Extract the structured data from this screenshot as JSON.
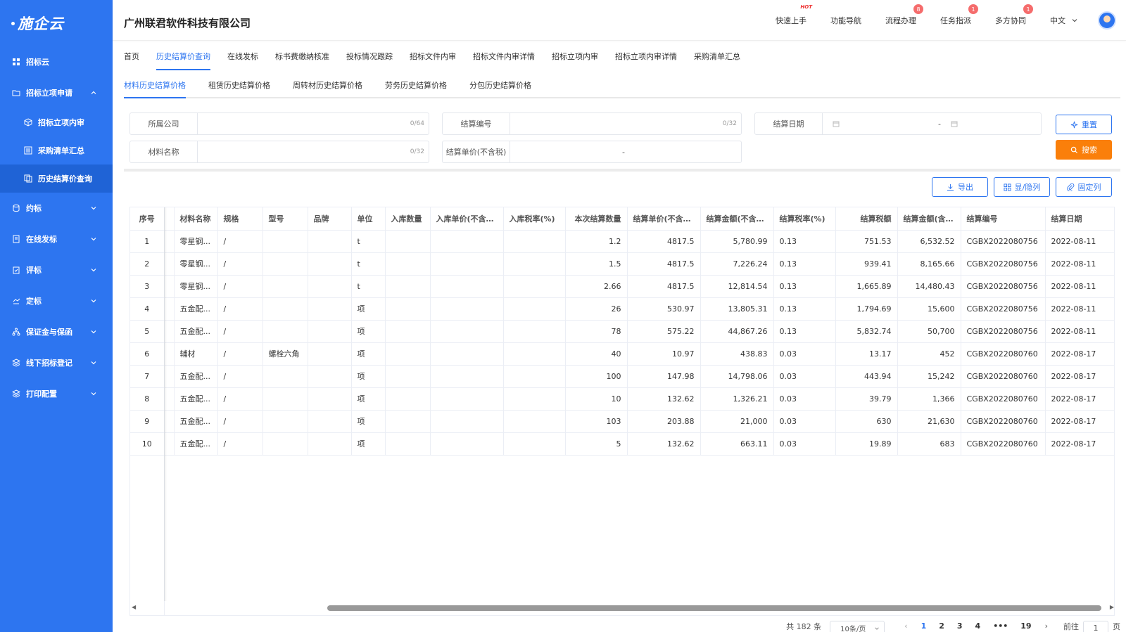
{
  "brand": {
    "logo_text": "施企云"
  },
  "sidebar": {
    "items": [
      {
        "label": "招标云",
        "icon": "grid-icon",
        "chevron": false
      },
      {
        "label": "招标立项申请",
        "icon": "folder-icon",
        "chevron": true,
        "expanded": true
      },
      {
        "label": "招标立项内审",
        "icon": "cube-icon",
        "sub": true
      },
      {
        "label": "采购清单汇总",
        "icon": "list-icon",
        "sub": true
      },
      {
        "label": "历史结算价查询",
        "icon": "copy-icon",
        "sub": true,
        "active": true
      },
      {
        "label": "约标",
        "icon": "coins-icon",
        "chevron": true
      },
      {
        "label": "在线发标",
        "icon": "doc-icon",
        "chevron": true
      },
      {
        "label": "评标",
        "icon": "clipboard-icon",
        "chevron": true
      },
      {
        "label": "定标",
        "icon": "hand-icon",
        "chevron": true
      },
      {
        "label": "保证金与保函",
        "icon": "tree-icon",
        "chevron": true
      },
      {
        "label": "线下招标登记",
        "icon": "layers-icon",
        "chevron": true
      },
      {
        "label": "打印配置",
        "icon": "layers-icon",
        "chevron": true
      }
    ]
  },
  "header": {
    "company": "广州联君软件科技有限公司",
    "links": [
      {
        "label": "快速上手",
        "hot": "HOT"
      },
      {
        "label": "功能导航"
      },
      {
        "label": "流程办理",
        "badge": "8"
      },
      {
        "label": "任务指派",
        "badge": "1"
      },
      {
        "label": "多方协同",
        "badge": "1"
      }
    ],
    "language": "中文"
  },
  "tabs_primary": [
    "首页",
    "历史结算价查询",
    "在线发标",
    "标书费缴纳核准",
    "投标情况跟踪",
    "招标文件内审",
    "招标文件内审详情",
    "招标立项内审",
    "招标立项内审详情",
    "采购清单汇总"
  ],
  "tabs_secondary": [
    "材料历史结算价格",
    "租赁历史结算价格",
    "周转材历史结算价格",
    "劳务历史结算价格",
    "分包历史结算价格"
  ],
  "filters": {
    "company": {
      "label": "所属公司",
      "counter": "0/64"
    },
    "settle_no": {
      "label": "结算编号",
      "counter": "0/32"
    },
    "settle_date": {
      "label": "结算日期",
      "sep": "-"
    },
    "material": {
      "label": "材料名称",
      "counter": "0/32"
    },
    "unit_price": {
      "label": "结算单价(不含税)",
      "sep": "-"
    }
  },
  "buttons": {
    "reset": "重置",
    "search": "搜索",
    "export": "导出",
    "toggle_cols": "显/隐列",
    "fix_cols": "固定列"
  },
  "table": {
    "columns": [
      "序号",
      "材料名称",
      "规格",
      "型号",
      "品牌",
      "单位",
      "入库数量",
      "入库单价(不含税)",
      "入库税率(%)",
      "本次结算数量",
      "结算单价(不含税)",
      "结算金额(不含税)",
      "结算税率(%)",
      "结算税额",
      "结算金额(含税)",
      "结算编号",
      "结算日期"
    ],
    "rows": [
      [
        "1",
        "零星钢...",
        "/",
        "",
        "",
        "t",
        "",
        "",
        "",
        "1.2",
        "4817.5",
        "5,780.99",
        "0.13",
        "751.53",
        "6,532.52",
        "CGBX2022080756",
        "2022-08-11"
      ],
      [
        "2",
        "零星钢...",
        "/",
        "",
        "",
        "t",
        "",
        "",
        "",
        "1.5",
        "4817.5",
        "7,226.24",
        "0.13",
        "939.41",
        "8,165.66",
        "CGBX2022080756",
        "2022-08-11"
      ],
      [
        "3",
        "零星钢...",
        "/",
        "",
        "",
        "t",
        "",
        "",
        "",
        "2.66",
        "4817.5",
        "12,814.54",
        "0.13",
        "1,665.89",
        "14,480.43",
        "CGBX2022080756",
        "2022-08-11"
      ],
      [
        "4",
        "五金配...",
        "/",
        "",
        "",
        "项",
        "",
        "",
        "",
        "26",
        "530.97",
        "13,805.31",
        "0.13",
        "1,794.69",
        "15,600",
        "CGBX2022080756",
        "2022-08-11"
      ],
      [
        "5",
        "五金配...",
        "/",
        "",
        "",
        "项",
        "",
        "",
        "",
        "78",
        "575.22",
        "44,867.26",
        "0.13",
        "5,832.74",
        "50,700",
        "CGBX2022080756",
        "2022-08-11"
      ],
      [
        "6",
        "辅材",
        "/",
        "螺栓六角",
        "",
        "项",
        "",
        "",
        "",
        "40",
        "10.97",
        "438.83",
        "0.03",
        "13.17",
        "452",
        "CGBX2022080760",
        "2022-08-17"
      ],
      [
        "7",
        "五金配...",
        "/",
        "",
        "",
        "项",
        "",
        "",
        "",
        "100",
        "147.98",
        "14,798.06",
        "0.03",
        "443.94",
        "15,242",
        "CGBX2022080760",
        "2022-08-17"
      ],
      [
        "8",
        "五金配...",
        "/",
        "",
        "",
        "项",
        "",
        "",
        "",
        "10",
        "132.62",
        "1,326.21",
        "0.03",
        "39.79",
        "1,366",
        "CGBX2022080760",
        "2022-08-17"
      ],
      [
        "9",
        "五金配...",
        "/",
        "",
        "",
        "项",
        "",
        "",
        "",
        "103",
        "203.88",
        "21,000",
        "0.03",
        "630",
        "21,630",
        "CGBX2022080760",
        "2022-08-17"
      ],
      [
        "10",
        "五金配...",
        "/",
        "",
        "",
        "项",
        "",
        "",
        "",
        "5",
        "132.62",
        "663.11",
        "0.03",
        "19.89",
        "683",
        "CGBX2022080760",
        "2022-08-17"
      ]
    ]
  },
  "pagination": {
    "total": "共 182 条",
    "page_size": "10条/页",
    "pages": [
      "1",
      "2",
      "3",
      "4",
      "•••",
      "19"
    ],
    "current": "1",
    "goto_label": "前往",
    "goto_value": "1",
    "page_suffix": "页"
  }
}
